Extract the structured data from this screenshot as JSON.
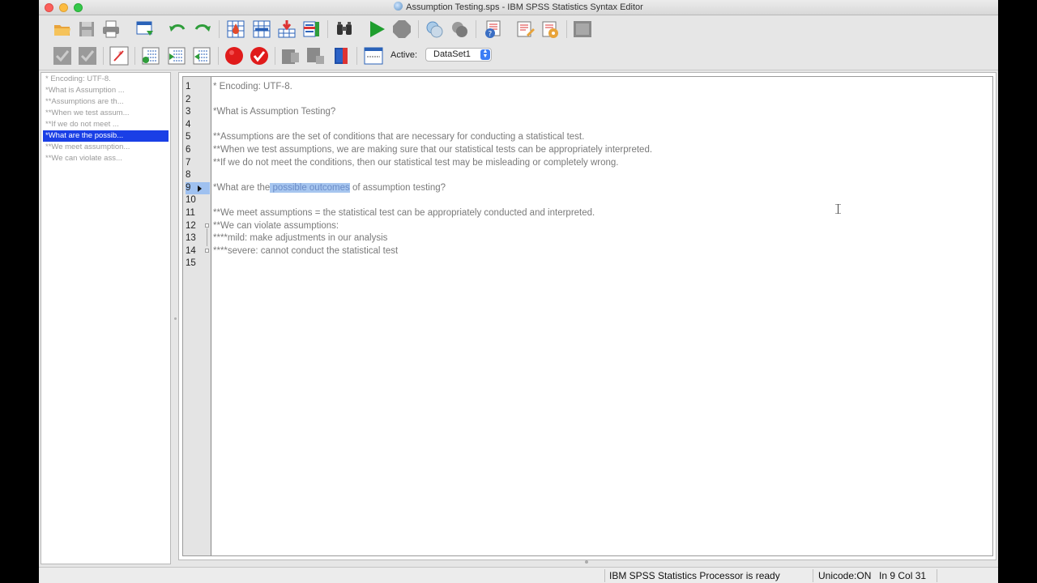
{
  "window": {
    "title": "Assumption Testing.sps - IBM SPSS Statistics Syntax Editor"
  },
  "toolbar1": {
    "icons": [
      "open-icon",
      "save-icon",
      "print-icon",
      "recall-dialog-icon",
      "undo-icon",
      "redo-icon",
      "goto-case-icon",
      "goto-variable-icon",
      "insert-cases-icon",
      "variables-icon",
      "find-icon",
      "run-icon",
      "stop-icon",
      "create-edit-icon",
      "delete-icon",
      "syntax-help-icon",
      "edit-syntax-icon",
      "output-options-icon",
      "designate-window-icon"
    ]
  },
  "toolbar2": {
    "active_label": "Active:",
    "active_dataset": "DataSet1"
  },
  "navigation": {
    "items": [
      {
        "label": "* Encoding: UTF-8.",
        "selected": false
      },
      {
        "label": "*What is Assumption ...",
        "selected": false
      },
      {
        "label": "**Assumptions are th...",
        "selected": false
      },
      {
        "label": "**When we test assum...",
        "selected": false
      },
      {
        "label": "**If we do not meet ...",
        "selected": false
      },
      {
        "label": "*What are the possib...",
        "selected": true
      },
      {
        "label": "**We meet assumption...",
        "selected": false
      },
      {
        "label": "**We can violate ass...",
        "selected": false
      }
    ]
  },
  "editor": {
    "current_line": 9,
    "lines": [
      {
        "number": "1",
        "text": "* Encoding: UTF-8."
      },
      {
        "number": "2",
        "text": ""
      },
      {
        "number": "3",
        "text": "*What is Assumption Testing?"
      },
      {
        "number": "4",
        "text": ""
      },
      {
        "number": "5",
        "text": "**Assumptions are the set of conditions that are necessary for conducting a statistical test."
      },
      {
        "number": "6",
        "text": "**When we test assumptions, we are making sure that our statistical tests can be appropriately interpreted."
      },
      {
        "number": "7",
        "text": "**If we do not meet the conditions, then our statistical test may be misleading or completely wrong."
      },
      {
        "number": "8",
        "text": ""
      },
      {
        "number": "9",
        "text_before": "*What are the",
        "highlight": " possible outcomes",
        "text_after": " of assumption testing?"
      },
      {
        "number": "10",
        "text": ""
      },
      {
        "number": "11",
        "text": "**We meet assumptions = the statistical test can be appropriately conducted and interpreted."
      },
      {
        "number": "12",
        "text": "**We can violate assumptions:"
      },
      {
        "number": "13",
        "text": "****mild: make adjustments in our analysis"
      },
      {
        "number": "14",
        "text": "****severe: cannot conduct the statistical test"
      },
      {
        "number": "15",
        "text": ""
      }
    ]
  },
  "status": {
    "processor": "IBM SPSS Statistics Processor is ready",
    "unicode": "Unicode:ON",
    "position": "In 9 Col 31"
  }
}
